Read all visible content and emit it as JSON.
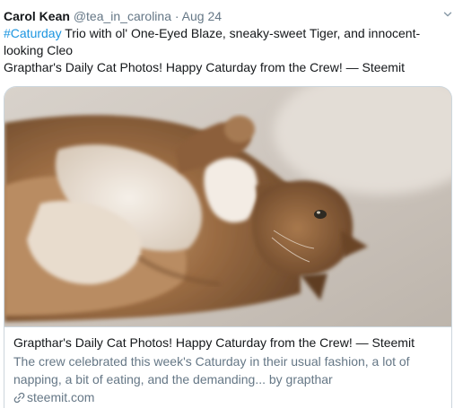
{
  "tweet": {
    "author_name": "Carol Kean",
    "handle": "@tea_in_carolina",
    "separator": "·",
    "date": "Aug 24",
    "hashtag": "#Caturday",
    "text_line1_rest": " Trio with ol' One-Eyed Blaze, sneaky-sweet Tiger, and innocent-looking Cleo",
    "text_line2": "Grapthar's Daily Cat Photos!  Happy Caturday from the Crew! — Steemit",
    "menu_icon": "chevron-down-icon"
  },
  "card": {
    "image_subject": "cat lying on its back on a carpet",
    "title": "Grapthar's Daily Cat Photos! Happy Caturday from the Crew! — Steemit",
    "description": "The crew celebrated this week's Caturday in their usual fashion, a lot of napping, a bit of eating, and the demanding... by grapthar",
    "domain": "steemit.com",
    "domain_icon": "link-icon"
  },
  "colors": {
    "hashtag": "#1b95e0",
    "secondary_text": "#657786",
    "primary_text": "#14171a",
    "border": "#ccd6dd"
  }
}
